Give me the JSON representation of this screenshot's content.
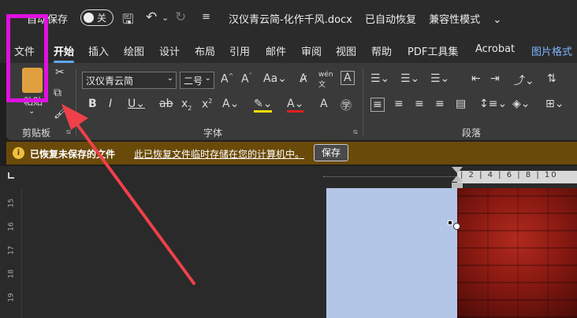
{
  "titlebar": {
    "autosave_label": "自动保存",
    "toggle_state": "关",
    "doc_name": "汉仪青云简-化作千风.docx",
    "save_state": "已自动恢复",
    "mode": "兼容性模式",
    "mode_caret": "⌄"
  },
  "tabs": [
    "文件",
    "开始",
    "插入",
    "绘图",
    "设计",
    "布局",
    "引用",
    "邮件",
    "审阅",
    "视图",
    "帮助",
    "PDF工具集",
    "Acrobat",
    "图片格式"
  ],
  "ribbon": {
    "font_name": "汉仪青云简",
    "font_size": "二号",
    "groups": {
      "clipboard": "剪贴板",
      "font": "字体",
      "paragraph": "段落"
    },
    "paste_label": "粘贴"
  },
  "infobar": {
    "title": "已恢复未保存的文件",
    "message": "此已恢复文件临时存储在您的计算机中。",
    "button": "保存"
  },
  "ruler": {
    "h_numbers": "| 2 | 4 | 6 | 8 | 10",
    "v_numbers": [
      "15",
      "16",
      "17",
      "18",
      "19"
    ]
  },
  "colors": {
    "highlight": "#e010e0",
    "arrow": "#f0404a",
    "accent": "#5fa8ff",
    "infobar": "#6a4a08"
  }
}
